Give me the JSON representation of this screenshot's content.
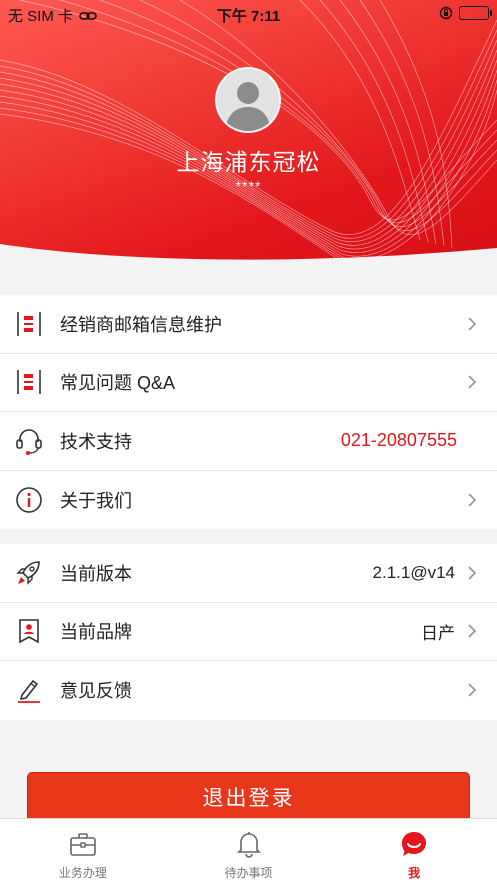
{
  "status_bar": {
    "carrier": "无 SIM 卡",
    "time": "下午 7:11"
  },
  "profile": {
    "name": "上海浦东冠松",
    "account": "****"
  },
  "menu_group_1": [
    {
      "label": "经销商邮箱信息维护",
      "value": "",
      "icon": "document-flag-icon"
    },
    {
      "label": "常见问题 Q&A",
      "value": "",
      "icon": "document-flag-icon"
    },
    {
      "label": "技术支持",
      "value": "021-20807555",
      "icon": "headset-icon"
    },
    {
      "label": "关于我们",
      "value": "",
      "icon": "info-icon"
    }
  ],
  "menu_group_2": [
    {
      "label": "当前版本",
      "value": "2.1.1@v14",
      "icon": "rocket-icon"
    },
    {
      "label": "当前品牌",
      "value": "日产",
      "icon": "badge-icon"
    },
    {
      "label": "意见反馈",
      "value": "",
      "icon": "pencil-icon"
    }
  ],
  "logout_label": "退出登录",
  "tabs": [
    {
      "label": "业务办理",
      "icon": "briefcase-icon",
      "active": false
    },
    {
      "label": "待办事项",
      "icon": "bell-icon",
      "active": false
    },
    {
      "label": "我",
      "icon": "me-chat-icon",
      "active": true
    }
  ],
  "colors": {
    "accent": "#e3171b",
    "logout": "#e8361a",
    "background": "#f4f4f4"
  }
}
